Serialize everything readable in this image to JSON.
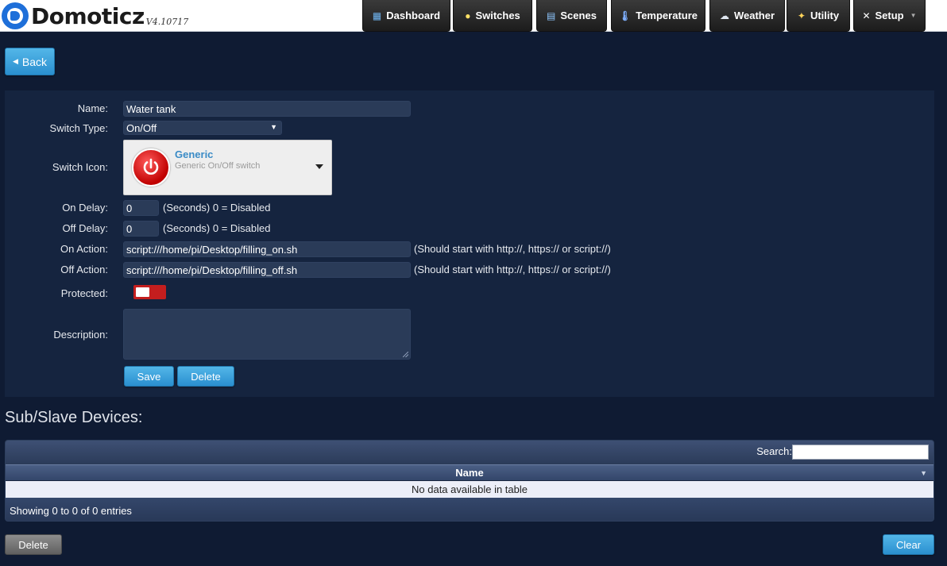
{
  "header": {
    "app_name": "Domoticz",
    "version": "V4.10717",
    "nav": [
      {
        "label": "Dashboard",
        "icon": "dashboard-icon"
      },
      {
        "label": "Switches",
        "icon": "lightbulb-icon"
      },
      {
        "label": "Scenes",
        "icon": "scenes-icon"
      },
      {
        "label": "Temperature",
        "icon": "thermometer-icon"
      },
      {
        "label": "Weather",
        "icon": "weather-icon"
      },
      {
        "label": "Utility",
        "icon": "utility-icon"
      },
      {
        "label": "Setup",
        "icon": "tools-icon",
        "has_dropdown": true
      }
    ]
  },
  "back_button": {
    "label": "Back"
  },
  "form": {
    "name_label": "Name:",
    "name_value": "Water tank",
    "switch_type_label": "Switch Type:",
    "switch_type_value": "On/Off",
    "switch_icon_label": "Switch Icon:",
    "icon_title": "Generic",
    "icon_subtitle": "Generic On/Off switch",
    "on_delay_label": "On Delay:",
    "on_delay_value": "0",
    "on_delay_hint": "(Seconds) 0 = Disabled",
    "off_delay_label": "Off Delay:",
    "off_delay_value": "0",
    "off_delay_hint": "(Seconds) 0 = Disabled",
    "on_action_label": "On Action:",
    "on_action_value": "script:///home/pi/Desktop/filling_on.sh",
    "on_action_hint": "(Should start with http://, https:// or script://)",
    "off_action_label": "Off Action:",
    "off_action_value": "script:///home/pi/Desktop/filling_off.sh",
    "off_action_hint": "(Should start with http://, https:// or script://)",
    "protected_label": "Protected:",
    "protected_on": false,
    "description_label": "Description:",
    "description_value": "",
    "save_label": "Save",
    "delete_label": "Delete"
  },
  "sub_devices": {
    "title": "Sub/Slave Devices:",
    "search_label": "Search:",
    "search_value": "",
    "column_name": "Name",
    "empty_text": "No data available in table",
    "info_text": "Showing 0 to 0 of 0 entries"
  },
  "footer": {
    "delete_label": "Delete",
    "clear_label": "Clear"
  },
  "colors": {
    "background": "#0f1b33",
    "panel": "#15243f",
    "accent_blue": "#2a8fcf",
    "toggle_off_red": "#c41e1e"
  }
}
